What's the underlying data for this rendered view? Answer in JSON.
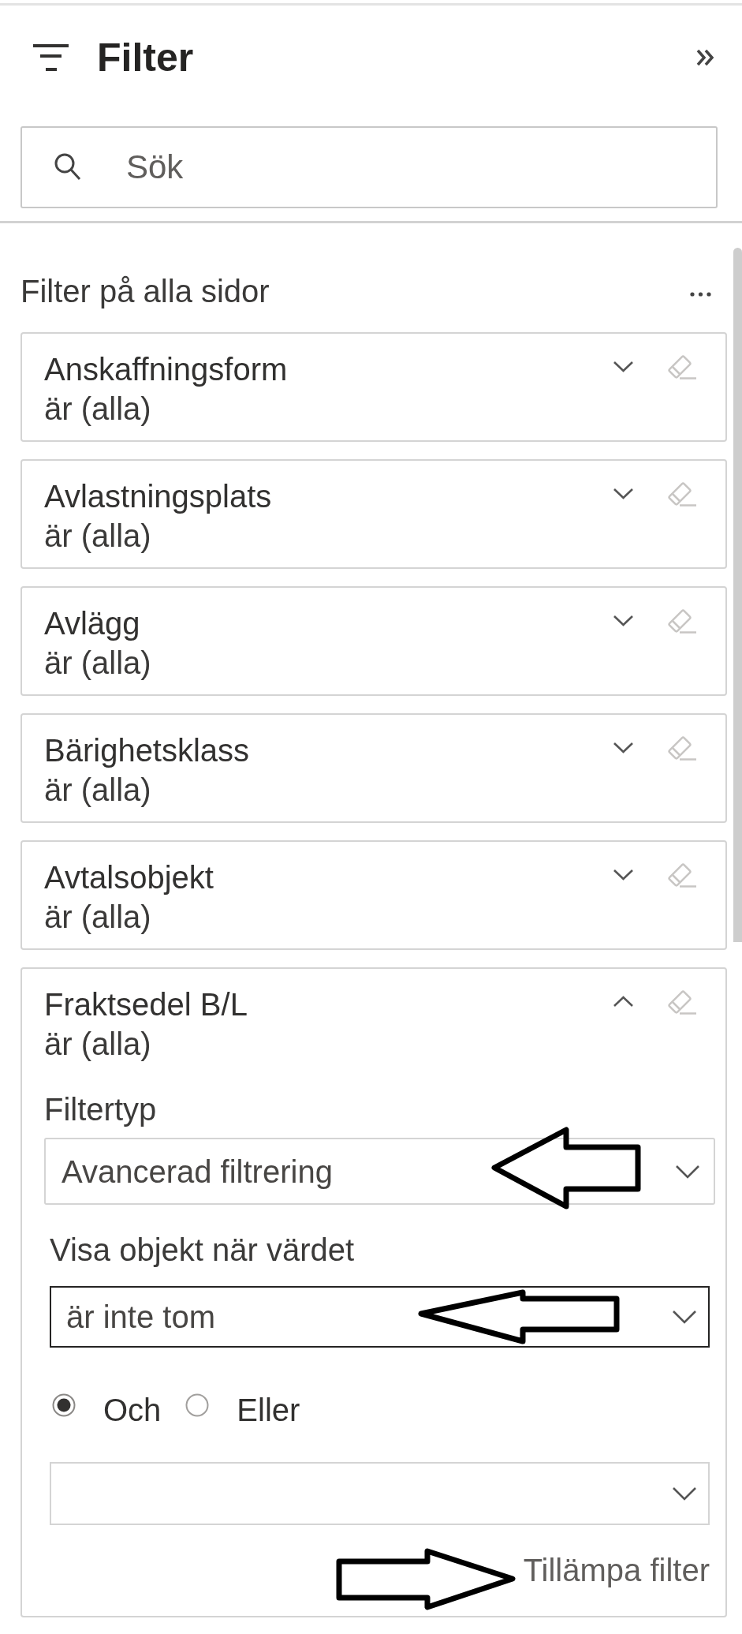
{
  "pane": {
    "title": "Filter"
  },
  "search": {
    "placeholder": "Sök"
  },
  "section": {
    "title": "Filter på alla sidor"
  },
  "filters": [
    {
      "name": "Anskaffningsform",
      "summary": "är (alla)",
      "expanded": false
    },
    {
      "name": "Avlastningsplats",
      "summary": "är (alla)",
      "expanded": false
    },
    {
      "name": "Avlägg",
      "summary": "är (alla)",
      "expanded": false
    },
    {
      "name": "Bärighetsklass",
      "summary": "är (alla)",
      "expanded": false
    },
    {
      "name": "Avtalsobjekt",
      "summary": "är (alla)",
      "expanded": false
    },
    {
      "name": "Fraktsedel B/L",
      "summary": "är (alla)",
      "expanded": true,
      "filter_type": {
        "label": "Filtertyp",
        "value": "Avancerad filtrering"
      },
      "condition": {
        "label": "Visa objekt när värdet",
        "value": "är inte tom",
        "focused": true
      },
      "logic": [
        {
          "label": "Och",
          "selected": true
        },
        {
          "label": "Eller",
          "selected": false
        }
      ],
      "apply_button": "Tillämpa filter"
    }
  ]
}
